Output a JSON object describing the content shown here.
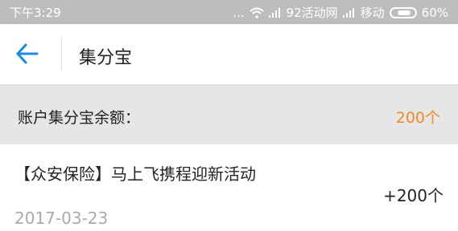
{
  "status_bar": {
    "time": "下午3:29",
    "dots": "...",
    "carrier1": "92活动网",
    "carrier2": "移动",
    "battery": "60%",
    "battery_level": 0.6
  },
  "header": {
    "title": "集分宝"
  },
  "balance": {
    "label": "账户集分宝余额：",
    "value": "200个",
    "value_color": "#f08a24"
  },
  "records": [
    {
      "title": "【众安保险】马上飞携程迎新活动",
      "date": "2017-03-23",
      "amount": "+200个"
    }
  ],
  "icons": {
    "back": "arrow-left-icon",
    "wifi": "wifi-icon",
    "signal": "signal-icon",
    "battery": "battery-icon"
  },
  "accent_color": "#1e88e5"
}
